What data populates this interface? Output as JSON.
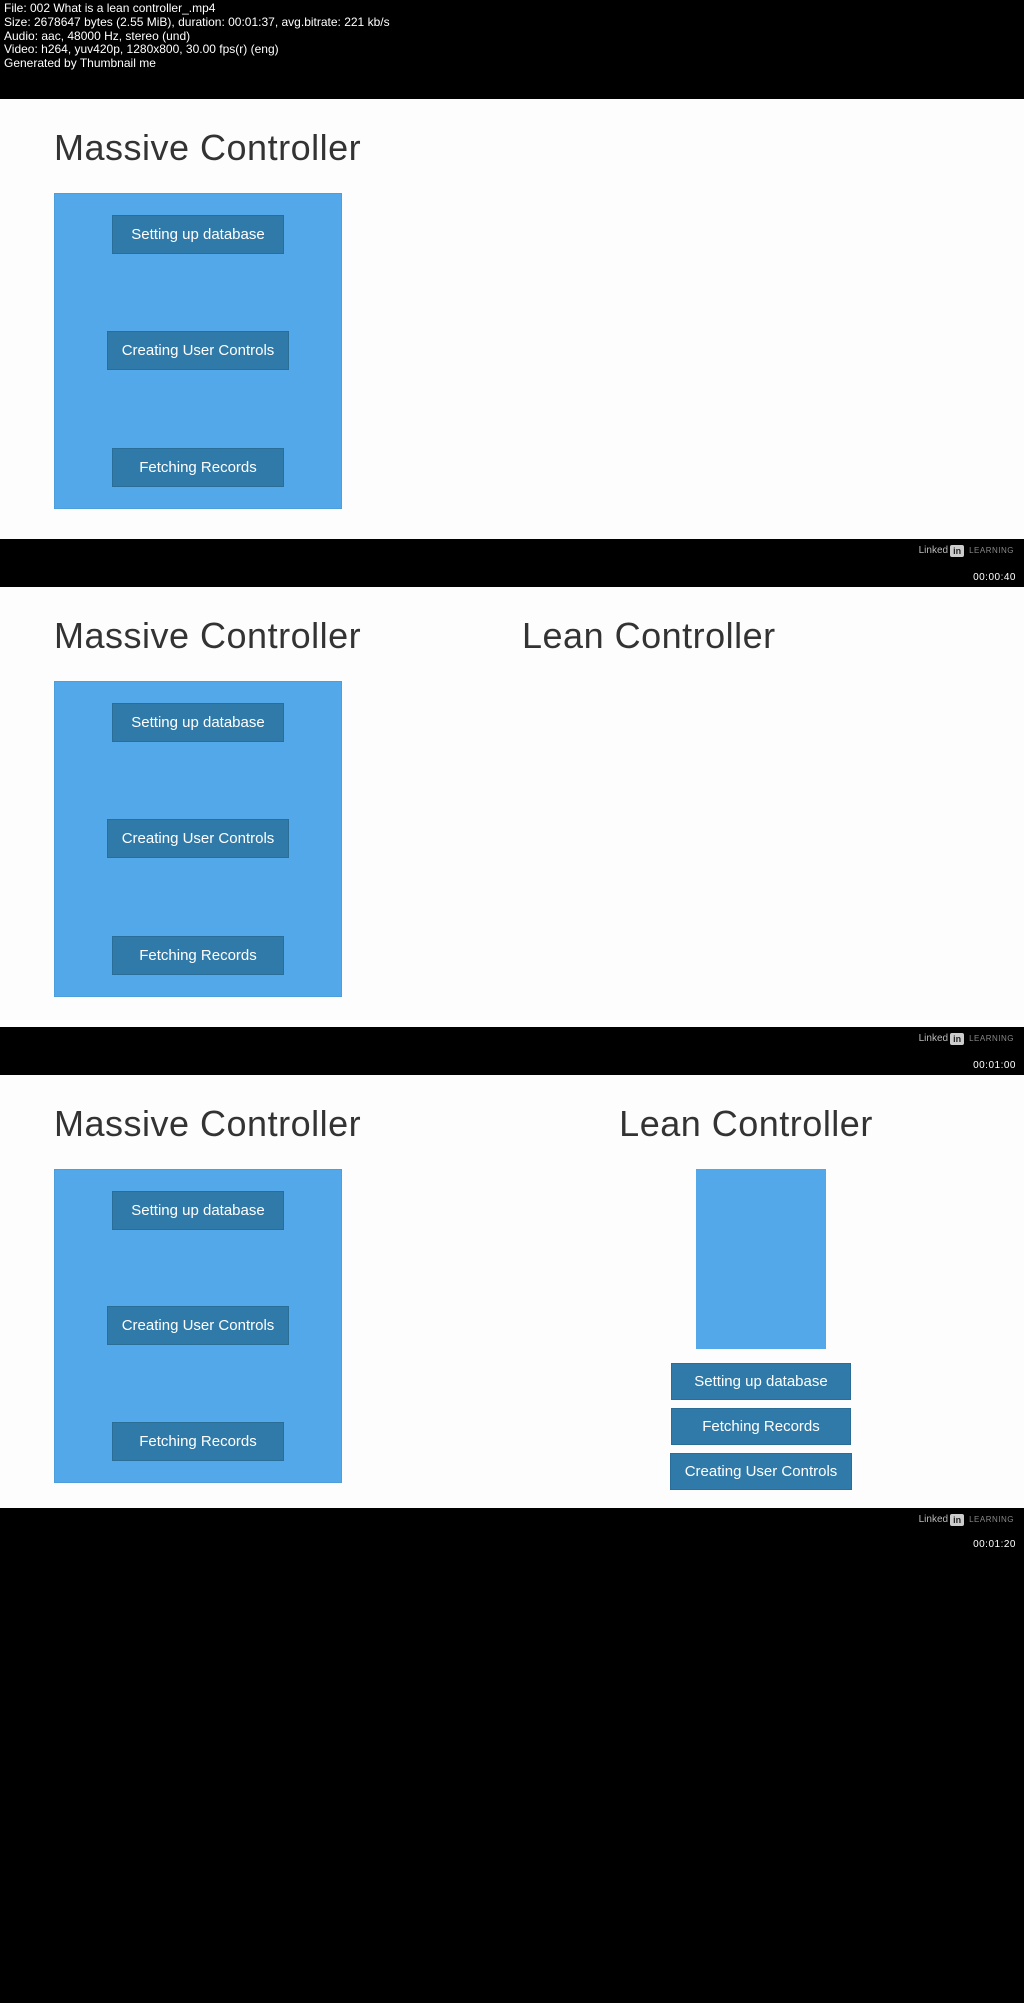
{
  "meta": {
    "file": "File: 002 What is a lean controller_.mp4",
    "size": "Size: 2678647 bytes (2.55 MiB), duration: 00:01:37, avg.bitrate: 221 kb/s",
    "audio": "Audio: aac, 48000 Hz, stereo (und)",
    "video": "Video: h264, yuv420p, 1280x800, 30.00 fps(r) (eng)",
    "gen": "Generated by Thumbnail me"
  },
  "brand": {
    "name": "Linked",
    "mark": "in",
    "learning": "LEARNING"
  },
  "timestamps": {
    "t1": "00:00:40",
    "t2": "00:01:00",
    "t3": "00:01:20"
  },
  "labels": {
    "massive": "Massive Controller",
    "lean": "Lean Controller",
    "setup": "Setting up database",
    "create": "Creating User Controls",
    "fetch": "Fetching Records"
  }
}
